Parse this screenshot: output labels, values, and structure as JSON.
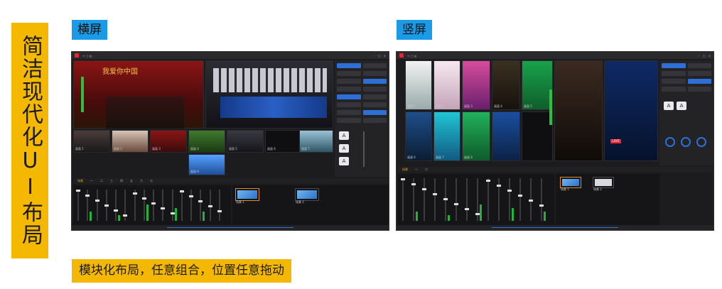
{
  "side_title": "简洁现代化UI布局",
  "landscape_tag": "横屏",
  "portrait_tag": "竖屏",
  "bottom_caption": "模块化布局，任意组合，位置任意拖动",
  "colors": {
    "accent_yellow": "#f5b800",
    "accent_blue": "#1a9be8",
    "app_bg": "#1c1c1e",
    "selected_orange": "#e58a1f",
    "ui_blue": "#2d6fd6"
  },
  "landscape_app": {
    "preview_banner": "我爱你中国",
    "grid_cells": [
      {
        "label": "画面 1"
      },
      {
        "label": "画面 2"
      },
      {
        "label": "画面 3"
      },
      {
        "label": "画面 4"
      },
      {
        "label": "画面 5"
      },
      {
        "label": "画面 6"
      },
      {
        "label": "画面 7"
      },
      {
        "label": "画面 8"
      }
    ],
    "tabs": [
      "场景",
      "一",
      "二",
      "三",
      "四",
      "五",
      "六",
      "七"
    ],
    "scene_labels": [
      "场景 1",
      "场景 2"
    ],
    "fader_count": 16
  },
  "portrait_app": {
    "grid_cells": [
      {
        "label": "画面 1"
      },
      {
        "label": "画面 2"
      },
      {
        "label": "画面 3"
      },
      {
        "label": "画面 4"
      },
      {
        "label": "画面 5"
      },
      {
        "label": "画面 6"
      },
      {
        "label": "画面 7"
      },
      {
        "label": "画面 8"
      }
    ],
    "tabs": [
      "场景",
      "一",
      "二"
    ],
    "scene_labels": [
      "场景 1",
      "场景 2"
    ],
    "fader_count": 14,
    "badge": "LIVE"
  },
  "big_button": "A"
}
